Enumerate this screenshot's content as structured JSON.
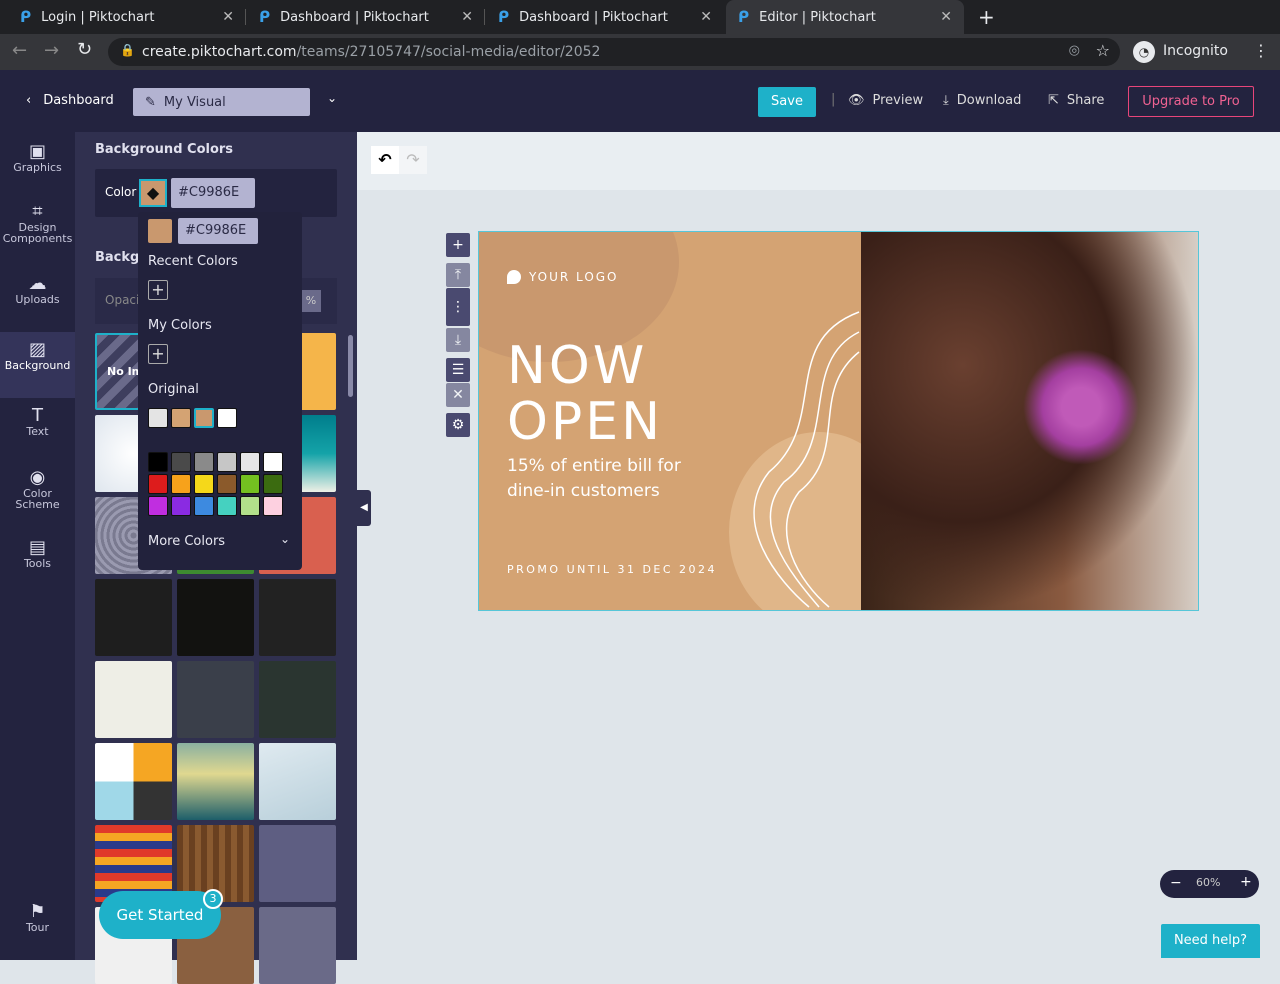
{
  "browser": {
    "tabs": [
      {
        "label": "Login | Piktochart"
      },
      {
        "label": "Dashboard | Piktochart"
      },
      {
        "label": "Dashboard | Piktochart"
      },
      {
        "label": "Editor | Piktochart"
      }
    ],
    "url_host": "create.piktochart.com",
    "url_path": "/teams/27105747/social-media/editor/2052",
    "profile": "Incognito"
  },
  "header": {
    "back": "Dashboard",
    "title": "My Visual",
    "save": "Save",
    "preview": "Preview",
    "download": "Download",
    "share": "Share",
    "upgrade": "Upgrade to Pro"
  },
  "sidebar": {
    "items": [
      {
        "label": "Graphics"
      },
      {
        "label": "Design Components"
      },
      {
        "label": "Uploads"
      },
      {
        "label": "Background"
      },
      {
        "label": "Text"
      },
      {
        "label": "Color Scheme"
      },
      {
        "label": "Tools"
      },
      {
        "label": "Tour"
      }
    ]
  },
  "panel": {
    "section_title": "Background Colors",
    "color_label": "Color",
    "color_value": "#C9986E",
    "section2_title": "Backgr",
    "opacity_label": "Opacit",
    "opacity_unit": "%",
    "no_image": "No Im",
    "get_started": "Get Started",
    "get_started_badge": "3"
  },
  "picker": {
    "hex": "#C9986E",
    "recent": "Recent Colors",
    "my_colors": "My Colors",
    "original": "Original",
    "more": "More Colors",
    "original_colors": [
      "#e4e4e4",
      "#d4a373",
      "#c9986e",
      "#ffffff"
    ],
    "palette": [
      "#000000",
      "#4a4a4a",
      "#8a8a8a",
      "#c6c6c6",
      "#e6e6e6",
      "#ffffff",
      "#dd1c1c",
      "#f7a21b",
      "#f5d81a",
      "#8b5a2b",
      "#74c020",
      "#3b6b10",
      "#c02ee0",
      "#8a2be2",
      "#3d8ae0",
      "#45d1c0",
      "#b2e08a",
      "#fdd0e0"
    ]
  },
  "design": {
    "logo": "YOUR LOGO",
    "headline1": "NOW",
    "headline2": "OPEN",
    "sub1": "15% of entire bill for",
    "sub2": "dine-in customers",
    "promo": "PROMO UNTIL 31 DEC 2024"
  },
  "zoom": {
    "value": "60%"
  },
  "help": "Need help?"
}
